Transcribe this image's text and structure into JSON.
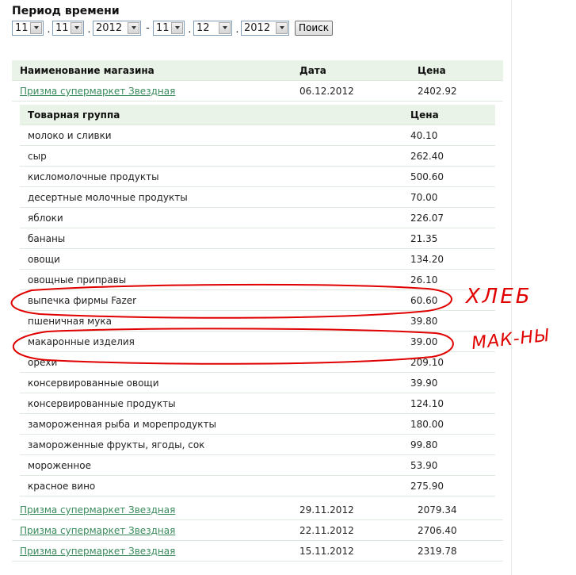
{
  "filter": {
    "title": "Период времени",
    "from": {
      "day": "11",
      "month": "11",
      "year": "2012"
    },
    "to": {
      "day": "11",
      "month": "12",
      "year": "2012"
    },
    "separator_dot": ".",
    "separator_dash": "-",
    "search_label": "Поиск"
  },
  "shops_table": {
    "headers": {
      "name": "Наименование магазина",
      "date": "Дата",
      "price": "Цена"
    },
    "rows": [
      {
        "name": "Призма супермаркет Звездная",
        "date": "06.12.2012",
        "price": "2402.92"
      },
      {
        "name": "Призма супермаркет Звездная",
        "date": "29.11.2012",
        "price": "2079.34"
      },
      {
        "name": "Призма супермаркет Звездная",
        "date": "22.11.2012",
        "price": "2706.40"
      },
      {
        "name": "Призма супермаркет Звездная",
        "date": "15.11.2012",
        "price": "2319.78"
      }
    ]
  },
  "items_table": {
    "headers": {
      "group": "Товарная группа",
      "price": "Цена"
    },
    "rows": [
      {
        "group": "молоко и сливки",
        "price": "40.10"
      },
      {
        "group": "сыр",
        "price": "262.40"
      },
      {
        "group": "кисломолочные продукты",
        "price": "500.60"
      },
      {
        "group": "десертные молочные продукты",
        "price": "70.00"
      },
      {
        "group": "яблоки",
        "price": "226.07"
      },
      {
        "group": "бананы",
        "price": "21.35"
      },
      {
        "group": "овощи",
        "price": "134.20"
      },
      {
        "group": "овощные приправы",
        "price": "26.10"
      },
      {
        "group": "выпечка фирмы Fazer",
        "price": "60.60"
      },
      {
        "group": "пшеничная мука",
        "price": "39.80"
      },
      {
        "group": "макаронные изделия",
        "price": "39.00"
      },
      {
        "group": "орехи",
        "price": "209.10"
      },
      {
        "group": "консервированные овощи",
        "price": "39.90"
      },
      {
        "group": "консервированные продукты",
        "price": "124.10"
      },
      {
        "group": "замороженная рыба и морепродукты",
        "price": "180.00"
      },
      {
        "group": "замороженные фрукты, ягоды, сок",
        "price": "99.80"
      },
      {
        "group": "мороженное",
        "price": "53.90"
      },
      {
        "group": "красное вино",
        "price": "275.90"
      }
    ]
  },
  "annotations": {
    "color": "#e00000",
    "bread_note": "ХЛЕБ",
    "pasta_note": "МАК-НЫ"
  }
}
